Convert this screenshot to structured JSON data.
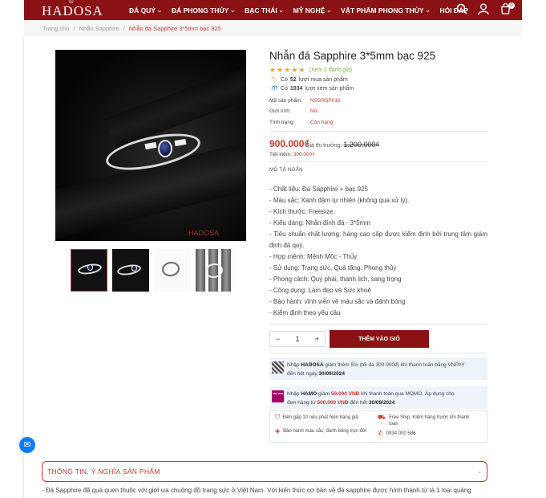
{
  "header": {
    "logo": "HADOSA",
    "nav": [
      {
        "label": "ĐÁ QUÝ",
        "dropdown": true
      },
      {
        "label": "ĐÁ PHONG THỦY",
        "dropdown": true
      },
      {
        "label": "BẠC THÁI",
        "dropdown": true
      },
      {
        "label": "MỸ NGHỆ",
        "dropdown": true
      },
      {
        "label": "VẬT PHẨM PHONG THỦY",
        "dropdown": true
      },
      {
        "label": "HỎI ĐÁP",
        "dropdown": false
      }
    ],
    "cart_count": "0",
    "icons": [
      "search-icon",
      "user-icon",
      "cart-icon"
    ]
  },
  "breadcrumb": {
    "home": "Trang chủ",
    "category": "Nhẫn Sapphire",
    "current": "Nhẫn đá Sapphire 3*5mm bạc 925"
  },
  "gallery": {
    "watermark": "HADOSA",
    "thumb_count": 4
  },
  "product": {
    "title": "Nhẫn đá Sapphire 3*5mm bạc 925",
    "rating": 5,
    "reviews_text": "(Xem 2 đánh giá)",
    "purchases_pre": "Có",
    "purchases": "52",
    "purchases_post": "lượt mua sản phẩm",
    "views_pre": "Có",
    "views": "1934",
    "views_post": "lượt xem sản phẩm",
    "sku_label": "Mã sản phẩm:",
    "sku": "NSSRSP016",
    "gender_label": "Giới tính:",
    "gender": "Nữ",
    "status_label": "Tình trạng:",
    "status": "Còn hàng",
    "price": "900.000₫",
    "market_label": "Giá thị trường:",
    "market_price": "1.200.000₫",
    "save_label": "Tiết kiệm:",
    "save": "300.000₫",
    "short_heading": "MÔ TẢ NGẮN",
    "description": [
      "- Chất liệu: Đá Sapphire + bạc 925",
      "- Màu sắc: Xanh đậm tự nhiên (không qua xử lý).",
      "- Kích thước: Freesize",
      "- Kiểu dáng: Nhẫn đính đá - 3*5mm",
      "- Tiêu chuẩn chất lượng: hàng cao cấp được kiểm định bởi trung tâm giám định đá quý.",
      "- Hợp mệnh: Mệnh Mộc - Thủy",
      "- Sử dụng: Trang sức, Quà tặng, Phong thủy",
      "- Phong cách: Quý phái, thanh lịch, sang trọng",
      "- Công dụng: Làm đẹp và Sức khoẻ",
      "- Bảo hành: vĩnh viễn về màu sắc và đánh bóng",
      "- Kiểm định theo yêu cầu"
    ],
    "quantity": "1",
    "minus": "−",
    "plus": "+",
    "add_to_cart": "THÊM VÀO GIỎ"
  },
  "promos": [
    {
      "line1a": "Nhập ",
      "code": "HADOSA",
      "line1b": " giảm thêm 5% (tối đa 300.000đ) khi thanh toán bằng VNPAY",
      "line2a": "đến hết ngày ",
      "date": "30/09/2024"
    },
    {
      "line1a": "Nhập ",
      "code": "HAMO",
      "line1b": " giảm ",
      "amount": "50.000 VNĐ",
      "line1c": " khi thanh toán qua MOMO. Áp dụng cho",
      "line2a": "đơn hàng từ ",
      "min": "500.000 VNĐ",
      "line2b": " đến hết ",
      "date": "30/09/2024",
      "logo": "mo mo"
    }
  ],
  "services": [
    {
      "text": "Đền gấp 10 nếu phát hiện hàng giả",
      "icon": "shield-icon"
    },
    {
      "text": "Free Ship, Kiểm hàng trước khi thanh toán",
      "icon": "truck-icon"
    },
    {
      "text": "Bảo hành màu sắc, đánh bóng trọn đời",
      "icon": "gem-icon"
    },
    {
      "text": "0934 000 586",
      "icon": "phone-icon"
    }
  ],
  "info_section": {
    "title": "THÔNG TIN, Ý NGHĨA SẢN PHẨM",
    "body": "- Đá Sapphire đã quá quen thuộc với giới ưa chuộng đồ trang sức ở Việt Nam. Với kiến thức cơ bản về đá sapphire được hình thành từ là 1 loại quảng"
  },
  "colors": {
    "brand": "#8b1214",
    "accent": "#c0392b",
    "star": "#f5a623"
  }
}
